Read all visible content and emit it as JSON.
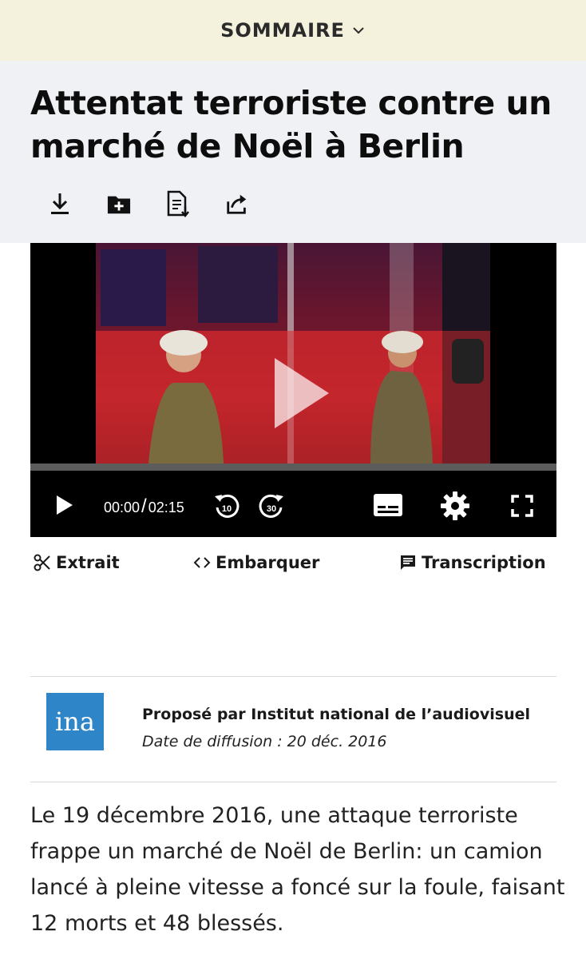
{
  "menu": {
    "label": "SOMMAIRE"
  },
  "article": {
    "title": "Attentat terroriste contre un marché de Noël à Berlin",
    "description": "Le 19 décembre 2016, une attaque terroriste frappe un marché de Noël de Berlin: un camion lancé à pleine vitesse a foncé sur la foule, faisant 12 morts et 48 blessés."
  },
  "toolbar": {
    "icons": [
      "download-icon",
      "add-to-folder-icon",
      "document-download-icon",
      "share-icon"
    ]
  },
  "player": {
    "current_time": "00:00",
    "separator": "/",
    "duration": "02:15",
    "rewind_label": "10",
    "forward_label": "30",
    "progress": 0
  },
  "actions": {
    "extract": "Extrait",
    "embed": "Embarquer",
    "transcript": "Transcription"
  },
  "provider": {
    "logo_text": "ina",
    "proposed_prefix": "Proposé par ",
    "name": "Institut national de l’audiovisuel",
    "broadcast_date": "Date de diffusion : 20 déc. 2016"
  },
  "colors": {
    "menu_bg": "#f4f1dc",
    "header_bg": "#eff1f4",
    "ina_blue": "#2e86c9"
  }
}
